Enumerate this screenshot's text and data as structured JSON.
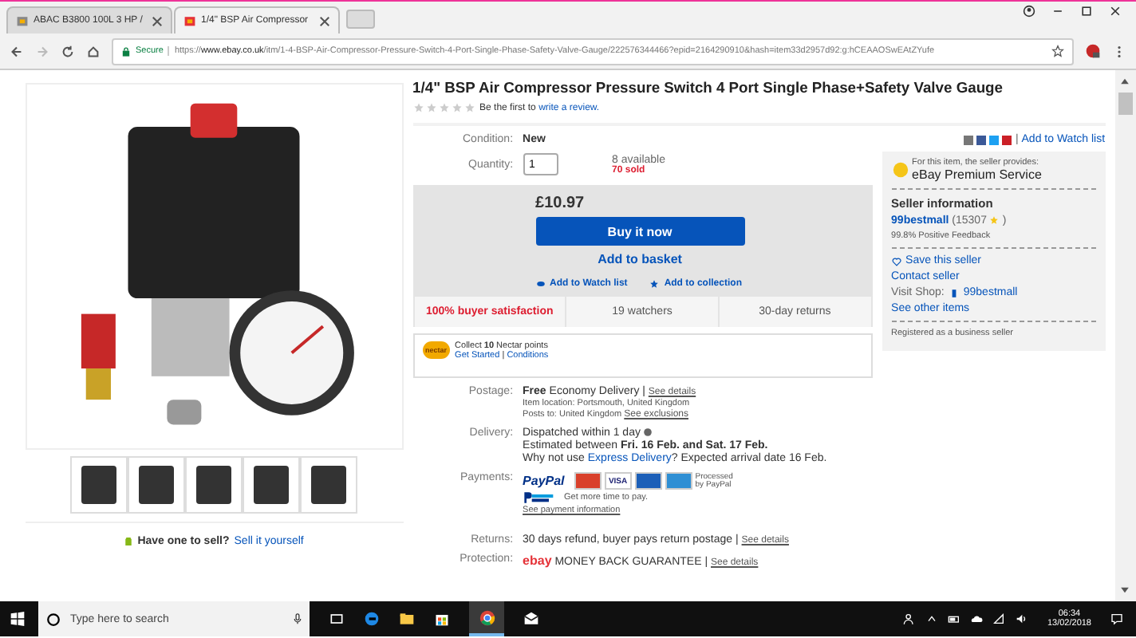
{
  "browser": {
    "tabs": [
      {
        "title": "ABAC B3800 100L 3 HP /",
        "selected": false
      },
      {
        "title": "1/4\" BSP Air Compressor",
        "selected": true
      }
    ],
    "secure_label": "Secure",
    "url_scheme": "https://",
    "url_host": "www.ebay.co.uk",
    "url_path": "/itm/1-4-BSP-Air-Compressor-Pressure-Switch-4-Port-Single-Phase-Safety-Valve-Gauge/222576344466?epid=2164290910&hash=item33d2957d92:g:hCEAAOSwEAtZYufe"
  },
  "gallery": {
    "sell_text": "Have one to sell?",
    "sell_link": "Sell it yourself"
  },
  "item": {
    "title": "1/4\" BSP Air Compressor Pressure Switch 4 Port Single Phase+Safety Valve Gauge",
    "stars": 0,
    "review_text": "Be the first to",
    "review_link": "write a review.",
    "share_separator": "|",
    "share_link": "Add to Watch list",
    "condition_label": "Condition:",
    "condition": "New",
    "quantity_label": "Quantity:",
    "quantity": "1",
    "available": "8 available",
    "sold": "70 sold",
    "price": "£10.97",
    "buy_button": "Buy it now",
    "basket_button": "Add to basket",
    "watch_link": "Add to Watch list",
    "collection_link": "Add to collection",
    "stats": [
      {
        "text": "100% buyer satisfaction",
        "highlight": true
      },
      {
        "text": "19 watchers",
        "highlight": false
      },
      {
        "text": "30-day returns",
        "highlight": false
      }
    ],
    "nectar": {
      "logo": "nectar",
      "text": "Collect **10** Nectar points",
      "get_started": "Get Started",
      "separator": "|",
      "conditions": "Conditions"
    },
    "postage": {
      "label": "Postage:",
      "price": "Free",
      "service": "Economy Delivery |",
      "link": "See details",
      "location_label": "Item location:",
      "location": "Portsmouth, United Kingdom",
      "posts_label": "Posts to:",
      "posts": "United Kingdom",
      "posts_link": "See exclusions"
    },
    "delivery": {
      "label": "Delivery:",
      "dispatch": "Dispatched within 1 day",
      "estimate": "Estimated between **Fri. 16 Feb. and Sat. 17 Feb.**",
      "express_before": "Why not use",
      "express_link": "Express Delivery",
      "express_after": "? Expected arrival date 16 Feb."
    },
    "payments": {
      "label": "Payments:",
      "logo": "PayPal",
      "cards": [
        {
          "kind": "mastercard"
        },
        {
          "kind": "visa",
          "label": "VISA"
        },
        {
          "kind": "maestro"
        },
        {
          "kind": "amex"
        }
      ],
      "processed": "Processed by PayPal",
      "credit_text": "Get more time to pay.",
      "info_link": "See payment information"
    },
    "returns": {
      "label": "Returns:",
      "text": "30 days refund, buyer pays return postage |",
      "link": "See details"
    },
    "protection": {
      "label": "Protection:",
      "logo": "ebay",
      "text": "MONEY BACK GUARANTEE |",
      "link": "See details"
    }
  },
  "seller": {
    "provides": "For this item, the seller provides:",
    "premium": "eBay Premium Service",
    "heading": "Seller information",
    "name": "99bestmall",
    "score": "(15307",
    "score_end": ")",
    "feedback": "99.8% Positive Feedback",
    "save": "Save this seller",
    "contact": "Contact seller",
    "shop_label": "Visit Shop:",
    "shop": "99bestmall",
    "other": "See other items",
    "registered": "Registered as a business seller"
  },
  "taskbar": {
    "search_placeholder": "Type here to search",
    "time": "06:34",
    "date": "13/02/2018"
  }
}
